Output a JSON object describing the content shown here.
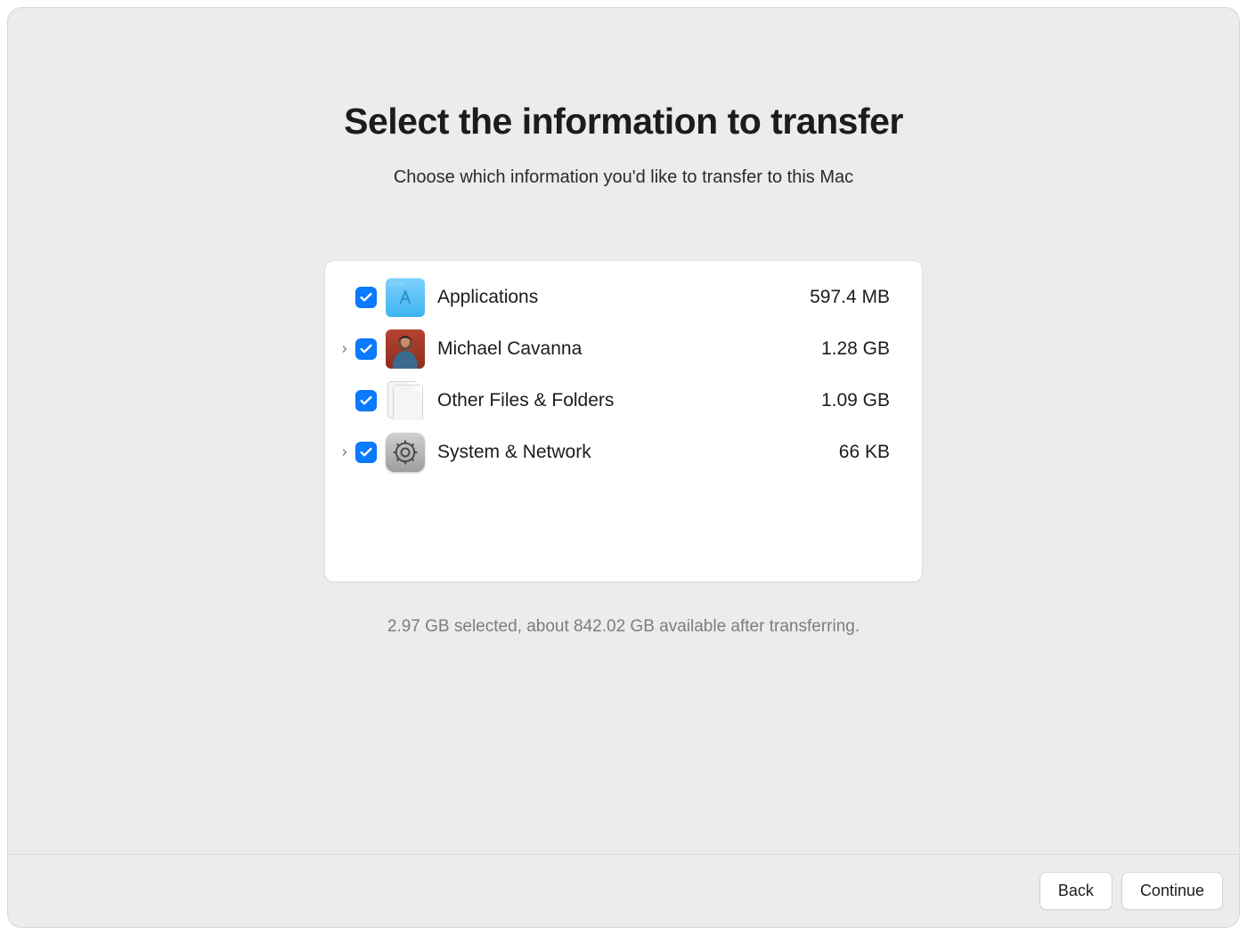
{
  "header": {
    "title": "Select the information to transfer",
    "subtitle": "Choose which information you'd like to transfer to this Mac"
  },
  "items": [
    {
      "label": "Applications",
      "size": "597.4 MB",
      "checked": true,
      "expandable": false,
      "icon": "apps-folder-icon"
    },
    {
      "label": "Michael Cavanna",
      "size": "1.28 GB",
      "checked": true,
      "expandable": true,
      "icon": "user-avatar-icon"
    },
    {
      "label": "Other Files & Folders",
      "size": "1.09 GB",
      "checked": true,
      "expandable": false,
      "icon": "documents-icon"
    },
    {
      "label": "System & Network",
      "size": "66 KB",
      "checked": true,
      "expandable": true,
      "icon": "system-prefs-icon"
    }
  ],
  "status": "2.97 GB selected, about 842.02 GB available after transferring.",
  "buttons": {
    "back": "Back",
    "continue": "Continue"
  }
}
